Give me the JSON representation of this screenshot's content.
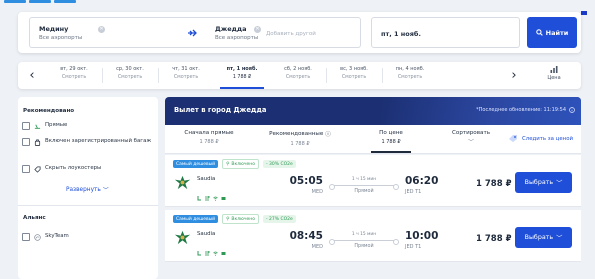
{
  "search": {
    "from_city": "Медину",
    "from_sub": "Все аэропорты",
    "to_city": "Джедда",
    "to_sub": "Все аэропорты",
    "to_add_placeholder": "Добавить другой",
    "date": "пт, 1 нояб.",
    "find_label": "Найти"
  },
  "dates": [
    {
      "label": "вт, 29 окт.",
      "price": "Смотреть"
    },
    {
      "label": "ср, 30 окт.",
      "price": "Смотреть"
    },
    {
      "label": "чт, 31 окт.",
      "price": "Смотреть"
    },
    {
      "label": "пт, 1 нояб.",
      "price": "1 788 ₽"
    },
    {
      "label": "сб, 2 нояб.",
      "price": "Смотреть"
    },
    {
      "label": "вс, 3 нояб.",
      "price": "Смотреть"
    },
    {
      "label": "пн, 4 нояб.",
      "price": "Смотреть"
    }
  ],
  "price_calendar_label": "Цена",
  "filters": {
    "recommended_title": "Рекомендовано",
    "direct": "Прямые",
    "baggage": "Включен зарегистрированный багаж",
    "hide_lowcost": "Скрыть лоукостеры",
    "expand": "Развернуть",
    "alliance_title": "Альянс",
    "skyteam": "SkyTeam"
  },
  "results": {
    "title": "Вылет в город Джедда",
    "updated": "*Последнее обновление: 11:19:54",
    "tabs": [
      {
        "label": "Сначала прямые",
        "price": "1 788 ₽"
      },
      {
        "label": "Рекомендованные",
        "price": "1 788 ₽"
      },
      {
        "label": "По цене",
        "price": "1 788 ₽"
      },
      {
        "label": "Сортировать",
        "price": ""
      }
    ],
    "track_price": "Следить за ценой"
  },
  "flights": [
    {
      "badge_cheap": "Самый дешевый",
      "badge_luggage": "Включено",
      "badge_co2": "- 30% CO2e",
      "airline": "Saudia",
      "dep_time": "05:05",
      "dep_airport": "MED",
      "duration": "1 ч 15 мин",
      "stops": "Прямой",
      "arr_time": "06:20",
      "arr_airport": "JED T1",
      "price": "1 788 ₽",
      "choose": "Выбрать"
    },
    {
      "badge_cheap": "Самый дешевый",
      "badge_luggage": "Включено",
      "badge_co2": "- 27% CO2e",
      "airline": "Saudia",
      "dep_time": "08:45",
      "dep_airport": "MED",
      "duration": "1 ч 15 мин",
      "stops": "Прямой",
      "arr_time": "10:00",
      "arr_airport": "JED T1",
      "price": "1 788 ₽",
      "choose": "Выбрать"
    }
  ],
  "colors": {
    "accent": "#1f4fd8",
    "header_bg": "#1b2f72",
    "green": "#2e9a54",
    "badge_blue": "#2f8ee0"
  }
}
